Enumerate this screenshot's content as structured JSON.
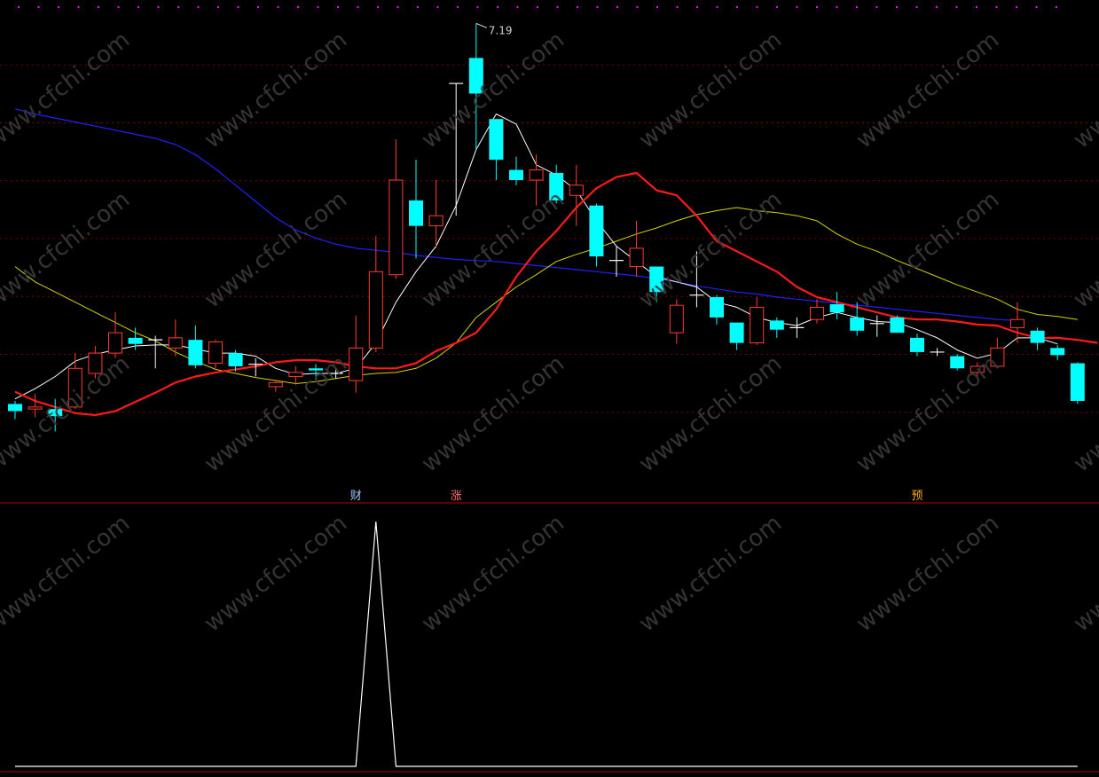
{
  "colors": {
    "background": "#000000",
    "up_candle": "#ff3b30",
    "down_candle": "#00ffff",
    "ma_white": "#ffffff",
    "ma_red": "#ff1a1a",
    "ma_yellow": "#d4d400",
    "ma_blue": "#2020ff",
    "grid": "#7a0000",
    "divider": "#b00000",
    "top_dot": "#ff00ff",
    "signal_cai": "#9ecbff",
    "signal_zhang": "#ff6b6b",
    "signal_yu": "#ffb000",
    "watermark": "#3a3a3a"
  },
  "watermark_text": "www.cfchi.com",
  "chart_data": [
    {
      "type": "candlestick",
      "title": "",
      "y_range": [
        2.8,
        7.35
      ],
      "grid": true,
      "high_label": {
        "text": "7.19",
        "bar_index": 23
      },
      "candles": [
        {
          "o": 3.45,
          "h": 3.48,
          "l": 3.3,
          "c": 3.38
        },
        {
          "o": 3.4,
          "h": 3.55,
          "l": 3.32,
          "c": 3.42
        },
        {
          "o": 3.4,
          "h": 3.5,
          "l": 3.18,
          "c": 3.33
        },
        {
          "o": 3.42,
          "h": 3.95,
          "l": 3.4,
          "c": 3.8
        },
        {
          "o": 3.75,
          "h": 4.02,
          "l": 3.7,
          "c": 3.95
        },
        {
          "o": 3.95,
          "h": 4.35,
          "l": 3.9,
          "c": 4.15
        },
        {
          "o": 4.1,
          "h": 4.2,
          "l": 3.98,
          "c": 4.04
        },
        {
          "o": 4.08,
          "h": 4.12,
          "l": 3.8,
          "c": 4.08
        },
        {
          "o": 4.0,
          "h": 4.28,
          "l": 3.92,
          "c": 4.1
        },
        {
          "o": 4.08,
          "h": 4.22,
          "l": 3.8,
          "c": 3.83
        },
        {
          "o": 3.85,
          "h": 4.08,
          "l": 3.8,
          "c": 4.06
        },
        {
          "o": 3.95,
          "h": 3.98,
          "l": 3.77,
          "c": 3.82
        },
        {
          "o": 3.84,
          "h": 3.9,
          "l": 3.72,
          "c": 3.84
        },
        {
          "o": 3.62,
          "h": 3.68,
          "l": 3.57,
          "c": 3.66
        },
        {
          "o": 3.72,
          "h": 3.82,
          "l": 3.64,
          "c": 3.76
        },
        {
          "o": 3.8,
          "h": 3.84,
          "l": 3.68,
          "c": 3.78
        },
        {
          "o": 3.75,
          "h": 3.8,
          "l": 3.7,
          "c": 3.75
        },
        {
          "o": 3.68,
          "h": 4.32,
          "l": 3.56,
          "c": 4.0
        },
        {
          "o": 4.0,
          "h": 5.1,
          "l": 3.96,
          "c": 4.75
        },
        {
          "o": 4.72,
          "h": 6.05,
          "l": 4.68,
          "c": 5.65
        },
        {
          "o": 5.45,
          "h": 5.85,
          "l": 4.88,
          "c": 5.2
        },
        {
          "o": 5.2,
          "h": 5.65,
          "l": 4.98,
          "c": 5.3
        },
        {
          "o": 6.6,
          "h": 6.6,
          "l": 5.3,
          "c": 6.6
        },
        {
          "o": 6.85,
          "h": 7.19,
          "l": 5.95,
          "c": 6.5
        },
        {
          "o": 6.25,
          "h": 6.25,
          "l": 5.65,
          "c": 5.85
        },
        {
          "o": 5.75,
          "h": 5.88,
          "l": 5.6,
          "c": 5.65
        },
        {
          "o": 5.65,
          "h": 5.9,
          "l": 5.4,
          "c": 5.75
        },
        {
          "o": 5.72,
          "h": 5.8,
          "l": 5.42,
          "c": 5.45
        },
        {
          "o": 5.5,
          "h": 5.8,
          "l": 5.2,
          "c": 5.6
        },
        {
          "o": 5.4,
          "h": 5.42,
          "l": 4.8,
          "c": 4.9
        },
        {
          "o": 4.86,
          "h": 5.0,
          "l": 4.7,
          "c": 4.86
        },
        {
          "o": 4.8,
          "h": 5.25,
          "l": 4.7,
          "c": 4.98
        },
        {
          "o": 4.8,
          "h": 4.8,
          "l": 4.45,
          "c": 4.55
        },
        {
          "o": 4.15,
          "h": 4.48,
          "l": 4.04,
          "c": 4.42
        },
        {
          "o": 4.52,
          "h": 4.95,
          "l": 4.4,
          "c": 4.52
        },
        {
          "o": 4.5,
          "h": 4.52,
          "l": 4.23,
          "c": 4.3
        },
        {
          "o": 4.25,
          "h": 4.25,
          "l": 3.98,
          "c": 4.05
        },
        {
          "o": 4.05,
          "h": 4.5,
          "l": 4.03,
          "c": 4.4
        },
        {
          "o": 4.27,
          "h": 4.3,
          "l": 4.1,
          "c": 4.18
        },
        {
          "o": 4.2,
          "h": 4.3,
          "l": 4.1,
          "c": 4.2
        },
        {
          "o": 4.28,
          "h": 4.48,
          "l": 4.24,
          "c": 4.4
        },
        {
          "o": 4.43,
          "h": 4.55,
          "l": 4.28,
          "c": 4.35
        },
        {
          "o": 4.3,
          "h": 4.45,
          "l": 4.12,
          "c": 4.17
        },
        {
          "o": 4.24,
          "h": 4.32,
          "l": 4.11,
          "c": 4.24
        },
        {
          "o": 4.3,
          "h": 4.32,
          "l": 4.15,
          "c": 4.15
        },
        {
          "o": 4.1,
          "h": 4.14,
          "l": 3.92,
          "c": 3.96
        },
        {
          "o": 3.96,
          "h": 4.0,
          "l": 3.92,
          "c": 3.96
        },
        {
          "o": 3.92,
          "h": 3.94,
          "l": 3.78,
          "c": 3.8
        },
        {
          "o": 3.76,
          "h": 3.86,
          "l": 3.72,
          "c": 3.82
        },
        {
          "o": 3.82,
          "h": 4.1,
          "l": 3.8,
          "c": 4.0
        },
        {
          "o": 4.2,
          "h": 4.45,
          "l": 4.05,
          "c": 4.28
        },
        {
          "o": 4.17,
          "h": 4.2,
          "l": 3.98,
          "c": 4.05
        },
        {
          "o": 4.0,
          "h": 4.03,
          "l": 3.88,
          "c": 3.93
        },
        {
          "o": 3.85,
          "h": 3.86,
          "l": 3.45,
          "c": 3.48
        }
      ],
      "moving_averages": [
        {
          "color": "white",
          "values": [
            3.5,
            3.6,
            3.72,
            3.87,
            3.94,
            3.98,
            4.02,
            4.03,
            4.03,
            3.99,
            3.95,
            3.95,
            3.92,
            3.8,
            3.74,
            3.75,
            3.75,
            3.8,
            4.05,
            4.45,
            4.75,
            5.0,
            5.4,
            5.95,
            6.3,
            6.2,
            5.8,
            5.7,
            5.55,
            5.25,
            5.0,
            4.85,
            4.7,
            4.65,
            4.6,
            4.45,
            4.4,
            4.3,
            4.25,
            4.22,
            4.3,
            4.35,
            4.3,
            4.26,
            4.25,
            4.18,
            4.1,
            3.98,
            3.9,
            3.95,
            4.1,
            4.1,
            4.04
          ]
        },
        {
          "color": "red",
          "values": [
            3.57,
            3.48,
            3.42,
            3.36,
            3.34,
            3.38,
            3.47,
            3.56,
            3.66,
            3.72,
            3.76,
            3.79,
            3.82,
            3.86,
            3.88,
            3.88,
            3.86,
            3.82,
            3.8,
            3.8,
            3.85,
            3.97,
            4.05,
            4.15,
            4.38,
            4.7,
            4.95,
            5.15,
            5.38,
            5.57,
            5.68,
            5.72,
            5.55,
            5.5,
            5.3,
            5.05,
            4.95,
            4.85,
            4.75,
            4.6,
            4.5,
            4.45,
            4.4,
            4.35,
            4.3,
            4.28,
            4.28,
            4.26,
            4.23,
            4.22,
            4.15,
            4.1,
            4.1,
            4.08,
            4.05
          ]
        },
        {
          "color": "yellow",
          "values": [
            4.8,
            4.65,
            4.55,
            4.45,
            4.35,
            4.25,
            4.15,
            4.07,
            3.96,
            3.87,
            3.79,
            3.75,
            3.71,
            3.68,
            3.65,
            3.67,
            3.7,
            3.73,
            3.75,
            3.76,
            3.8,
            3.9,
            4.05,
            4.3,
            4.45,
            4.6,
            4.72,
            4.85,
            4.92,
            4.98,
            5.05,
            5.12,
            5.18,
            5.25,
            5.31,
            5.35,
            5.38,
            5.35,
            5.33,
            5.3,
            5.25,
            5.12,
            5.02,
            4.95,
            4.86,
            4.78,
            4.7,
            4.62,
            4.55,
            4.48,
            4.38,
            4.33,
            4.31,
            4.28
          ]
        },
        {
          "color": "blue",
          "values": [
            6.35,
            6.3,
            6.26,
            6.22,
            6.18,
            6.14,
            6.1,
            6.06,
            6.0,
            5.9,
            5.76,
            5.6,
            5.44,
            5.28,
            5.16,
            5.08,
            5.02,
            4.98,
            4.96,
            4.94,
            4.91,
            4.89,
            4.87,
            4.86,
            4.85,
            4.83,
            4.81,
            4.79,
            4.77,
            4.75,
            4.73,
            4.71,
            4.68,
            4.65,
            4.61,
            4.58,
            4.55,
            4.53,
            4.5,
            4.48,
            4.46,
            4.44,
            4.42,
            4.4,
            4.38,
            4.36,
            4.34,
            4.32,
            4.3,
            4.28,
            4.27
          ]
        }
      ],
      "signals": [
        {
          "label": "财",
          "bar_index": 17,
          "color_key": "signal_cai"
        },
        {
          "label": "涨",
          "bar_index": 22,
          "color_key": "signal_zhang"
        },
        {
          "label": "预",
          "bar_index": 45,
          "color_key": "signal_yu"
        }
      ]
    },
    {
      "type": "line",
      "title": "",
      "y_range": [
        0,
        1
      ],
      "x": [
        0,
        15,
        16,
        17,
        18,
        19,
        20,
        53
      ],
      "values": [
        0,
        0,
        0,
        0,
        1,
        0,
        0,
        0
      ]
    }
  ]
}
